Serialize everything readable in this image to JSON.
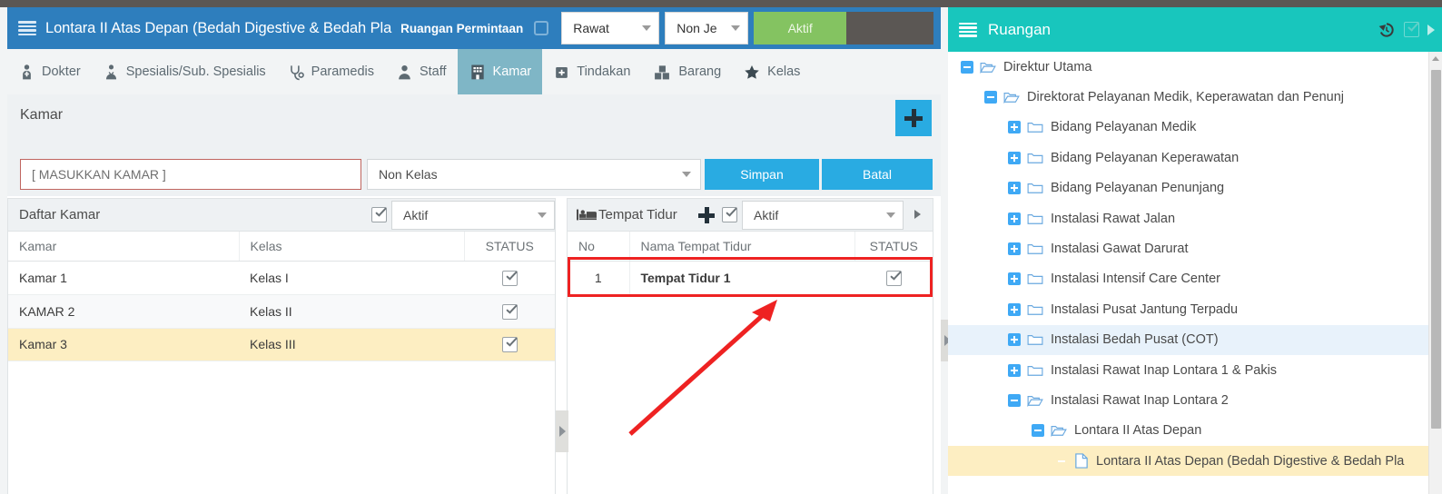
{
  "colors": {
    "header_blue": "#2e7ebd",
    "accent_blue": "#29abe2",
    "teal": "#18c6bd",
    "green": "#84c361",
    "dark_gray": "#5b5754",
    "row_selected": "#fdeec2",
    "tree_selected": "#e8f2fb",
    "annotation_red": "#ee2222",
    "active_tab": "#7fb6c6"
  },
  "header": {
    "hamburger_icon": "hamburger-menu-icon",
    "title": "Lontara II Atas Depan (Bedah Digestive & Bedah Pla",
    "subtitle": "Ruangan Permintaan",
    "checkbox_checked": false,
    "select_care_type": {
      "value": "Rawat",
      "icon": "chevron-down-icon"
    },
    "select_service": {
      "value": "Non Je",
      "icon": "chevron-down-icon"
    },
    "status_button": "Aktif",
    "gray_block": ""
  },
  "tabs": [
    {
      "label": "Dokter",
      "icon": "doctor-icon",
      "active": false
    },
    {
      "label": "Spesialis/Sub. Spesialis",
      "icon": "specialist-icon",
      "active": false
    },
    {
      "label": "Paramedis",
      "icon": "stethoscope-icon",
      "active": false
    },
    {
      "label": "Staff",
      "icon": "user-icon",
      "active": false
    },
    {
      "label": "Kamar",
      "icon": "hospital-building-icon",
      "active": true
    },
    {
      "label": "Tindakan",
      "icon": "medical-kit-icon",
      "active": false
    },
    {
      "label": "Barang",
      "icon": "boxes-icon",
      "active": false
    },
    {
      "label": "Kelas",
      "icon": "star-icon",
      "active": false
    }
  ],
  "section": {
    "title": "Kamar",
    "add_icon": "plus-icon"
  },
  "form": {
    "kamar_input_placeholder": "[ MASUKKAN KAMAR ]",
    "kamar_input_value": "",
    "kelas_select_value": "Non Kelas",
    "save_label": "Simpan",
    "cancel_label": "Batal"
  },
  "kamar_grid": {
    "bar_title": "Daftar Kamar",
    "bar_checkbox": "check-icon",
    "bar_filter_value": "Aktif",
    "columns": [
      "Kamar",
      "Kelas",
      "STATUS"
    ],
    "rows": [
      {
        "kamar": "Kamar 1",
        "kelas": "Kelas I",
        "status": "check-icon",
        "selected": false
      },
      {
        "kamar": "KAMAR 2",
        "kelas": "Kelas II",
        "status": "check-icon",
        "selected": false
      },
      {
        "kamar": "Kamar 3",
        "kelas": "Kelas III",
        "status": "check-icon",
        "selected": true
      }
    ]
  },
  "tempat_tidur_grid": {
    "bar_icon": "bed-icon",
    "bar_title": "Tempat Tidur",
    "bar_add_icon": "plus-icon",
    "bar_checkbox": "check-icon",
    "bar_filter_value": "Aktif",
    "bar_next_icon": "chevron-right-icon",
    "columns": [
      "No",
      "Nama Tempat Tidur",
      "STATUS"
    ],
    "rows": [
      {
        "no": "1",
        "nama": "Tempat Tidur 1",
        "status": "check-icon",
        "highlighted": true
      }
    ]
  },
  "splitters": [
    {
      "name": "collapse-handle-middle",
      "icon": "chevron-right-icon"
    },
    {
      "name": "collapse-handle-right",
      "icon": "chevron-right-icon"
    }
  ],
  "annotation": {
    "highlight_box": "red-rectangle-around-tempat-tidur-row",
    "arrow": "red-arrow-pointing-to-tempat-tidur-row"
  },
  "tree_panel": {
    "hamburger_icon": "hamburger-menu-icon",
    "title": "Ruangan",
    "history_icon": "history-undo-icon",
    "check_icon": "check-icon",
    "next_icon": "chevron-right-icon",
    "nodes": [
      {
        "label": "Direktur Utama",
        "depth": 0,
        "toggle": "minus",
        "icon": "folder-open-icon",
        "state": "none"
      },
      {
        "label": "Direktorat Pelayanan Medik, Keperawatan dan Penunj",
        "depth": 1,
        "toggle": "minus",
        "icon": "folder-open-icon",
        "state": "none"
      },
      {
        "label": "Bidang Pelayanan Medik",
        "depth": 2,
        "toggle": "plus",
        "icon": "folder-closed-icon",
        "state": "none"
      },
      {
        "label": "Bidang Pelayanan Keperawatan",
        "depth": 2,
        "toggle": "plus",
        "icon": "folder-closed-icon",
        "state": "none"
      },
      {
        "label": "Bidang Pelayanan Penunjang",
        "depth": 2,
        "toggle": "plus",
        "icon": "folder-closed-icon",
        "state": "none"
      },
      {
        "label": "Instalasi Rawat Jalan",
        "depth": 2,
        "toggle": "plus",
        "icon": "folder-closed-icon",
        "state": "none"
      },
      {
        "label": "Instalasi Gawat Darurat",
        "depth": 2,
        "toggle": "plus",
        "icon": "folder-closed-icon",
        "state": "none"
      },
      {
        "label": "Instalasi Intensif Care Center",
        "depth": 2,
        "toggle": "plus",
        "icon": "folder-closed-icon",
        "state": "none"
      },
      {
        "label": "Instalasi Pusat Jantung Terpadu",
        "depth": 2,
        "toggle": "plus",
        "icon": "folder-closed-icon",
        "state": "none"
      },
      {
        "label": "Instalasi Bedah Pusat (COT)",
        "depth": 2,
        "toggle": "plus",
        "icon": "folder-closed-icon",
        "state": "blue"
      },
      {
        "label": "Instalasi Rawat Inap Lontara 1 & Pakis",
        "depth": 2,
        "toggle": "plus",
        "icon": "folder-closed-icon",
        "state": "none"
      },
      {
        "label": "Instalasi Rawat Inap Lontara 2",
        "depth": 2,
        "toggle": "minus",
        "icon": "folder-open-icon",
        "state": "none"
      },
      {
        "label": "Lontara II Atas Depan",
        "depth": 3,
        "toggle": "minus",
        "icon": "folder-open-icon",
        "state": "none"
      },
      {
        "label": "Lontara II Atas Depan (Bedah Digestive & Bedah Pla",
        "depth": 4,
        "toggle": "none",
        "icon": "file-icon",
        "state": "yellow"
      }
    ]
  }
}
